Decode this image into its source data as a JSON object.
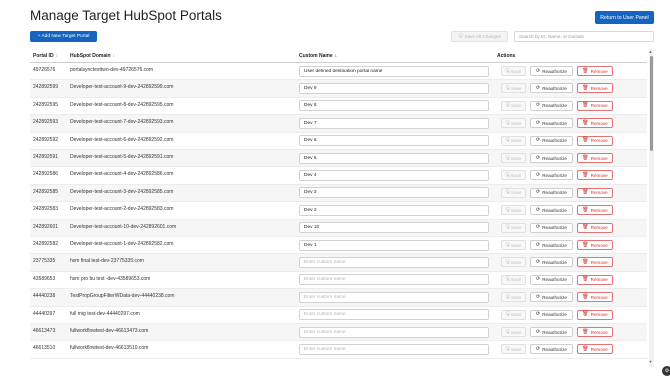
{
  "header": {
    "title": "Manage Target HubSpot Portals",
    "return_label": "Return to User Panel"
  },
  "toolbar": {
    "add_label": "+ Add New Target Portal",
    "save_all_label": "Save All Changes",
    "search_placeholder": "Search by ID, Name, or Domain"
  },
  "table": {
    "columns": {
      "portal_id": "Portal ID",
      "domain": "HubSpot Domain",
      "custom_name": "Custom Name",
      "actions": "Actions"
    },
    "name_placeholder": "Enter custom name",
    "save_label": "Save",
    "reauth_label": "Reauthorize",
    "remove_label": "Remove",
    "rows": [
      {
        "id": "49726576",
        "domain": "portalsynctesttwo-dev-49726576.com",
        "name": "User defined destination portal name"
      },
      {
        "id": "242892599",
        "domain": "Developer-test-account-9-dev-242892599.com",
        "name": "Dev 9"
      },
      {
        "id": "242892595",
        "domain": "Developer-test-account-8-dev-242892595.com",
        "name": "Dev 8"
      },
      {
        "id": "242892593",
        "domain": "Developer-test-account-7-dev-242892593.com",
        "name": "Dev 7"
      },
      {
        "id": "242892592",
        "domain": "Developer-test-account-6-dev-242892592.com",
        "name": "Dev 6"
      },
      {
        "id": "242892591",
        "domain": "Developer-test-account-5-dev-242892591.com",
        "name": "Dev 5"
      },
      {
        "id": "242892586",
        "domain": "Developer-test-account-4-dev-242892586.com",
        "name": "Dev 4"
      },
      {
        "id": "242892585",
        "domain": "Developer-test-account-3-dev-242892585.com",
        "name": "Dev 3"
      },
      {
        "id": "242892583",
        "domain": "Developer-test-account-2-dev-242892583.com",
        "name": "Dev 2"
      },
      {
        "id": "242892601",
        "domain": "Developer-test-account-10-dev-242892601.com",
        "name": "Dev 10"
      },
      {
        "id": "242892582",
        "domain": "Developer-test-account-1-dev-242892582.com",
        "name": "Dev 1"
      },
      {
        "id": "23775335",
        "domain": "hsm final test-dev-23775335.com",
        "name": ""
      },
      {
        "id": "43589653",
        "domain": "hsm pro bu test -dev-43589653.com",
        "name": ""
      },
      {
        "id": "44440238",
        "domain": "TestPropGroupFilterWData-dev-44440238.com",
        "name": ""
      },
      {
        "id": "44440297",
        "domain": "full mig test-dev-44440297.com",
        "name": ""
      },
      {
        "id": "46613473",
        "domain": "fullworkflowtest-dev-46613473.com",
        "name": ""
      },
      {
        "id": "46613510",
        "domain": "fullworkflowtest-dev-46613510.com",
        "name": ""
      }
    ]
  },
  "colors": {
    "primary": "#1565c0",
    "danger": "#d32f2f"
  }
}
